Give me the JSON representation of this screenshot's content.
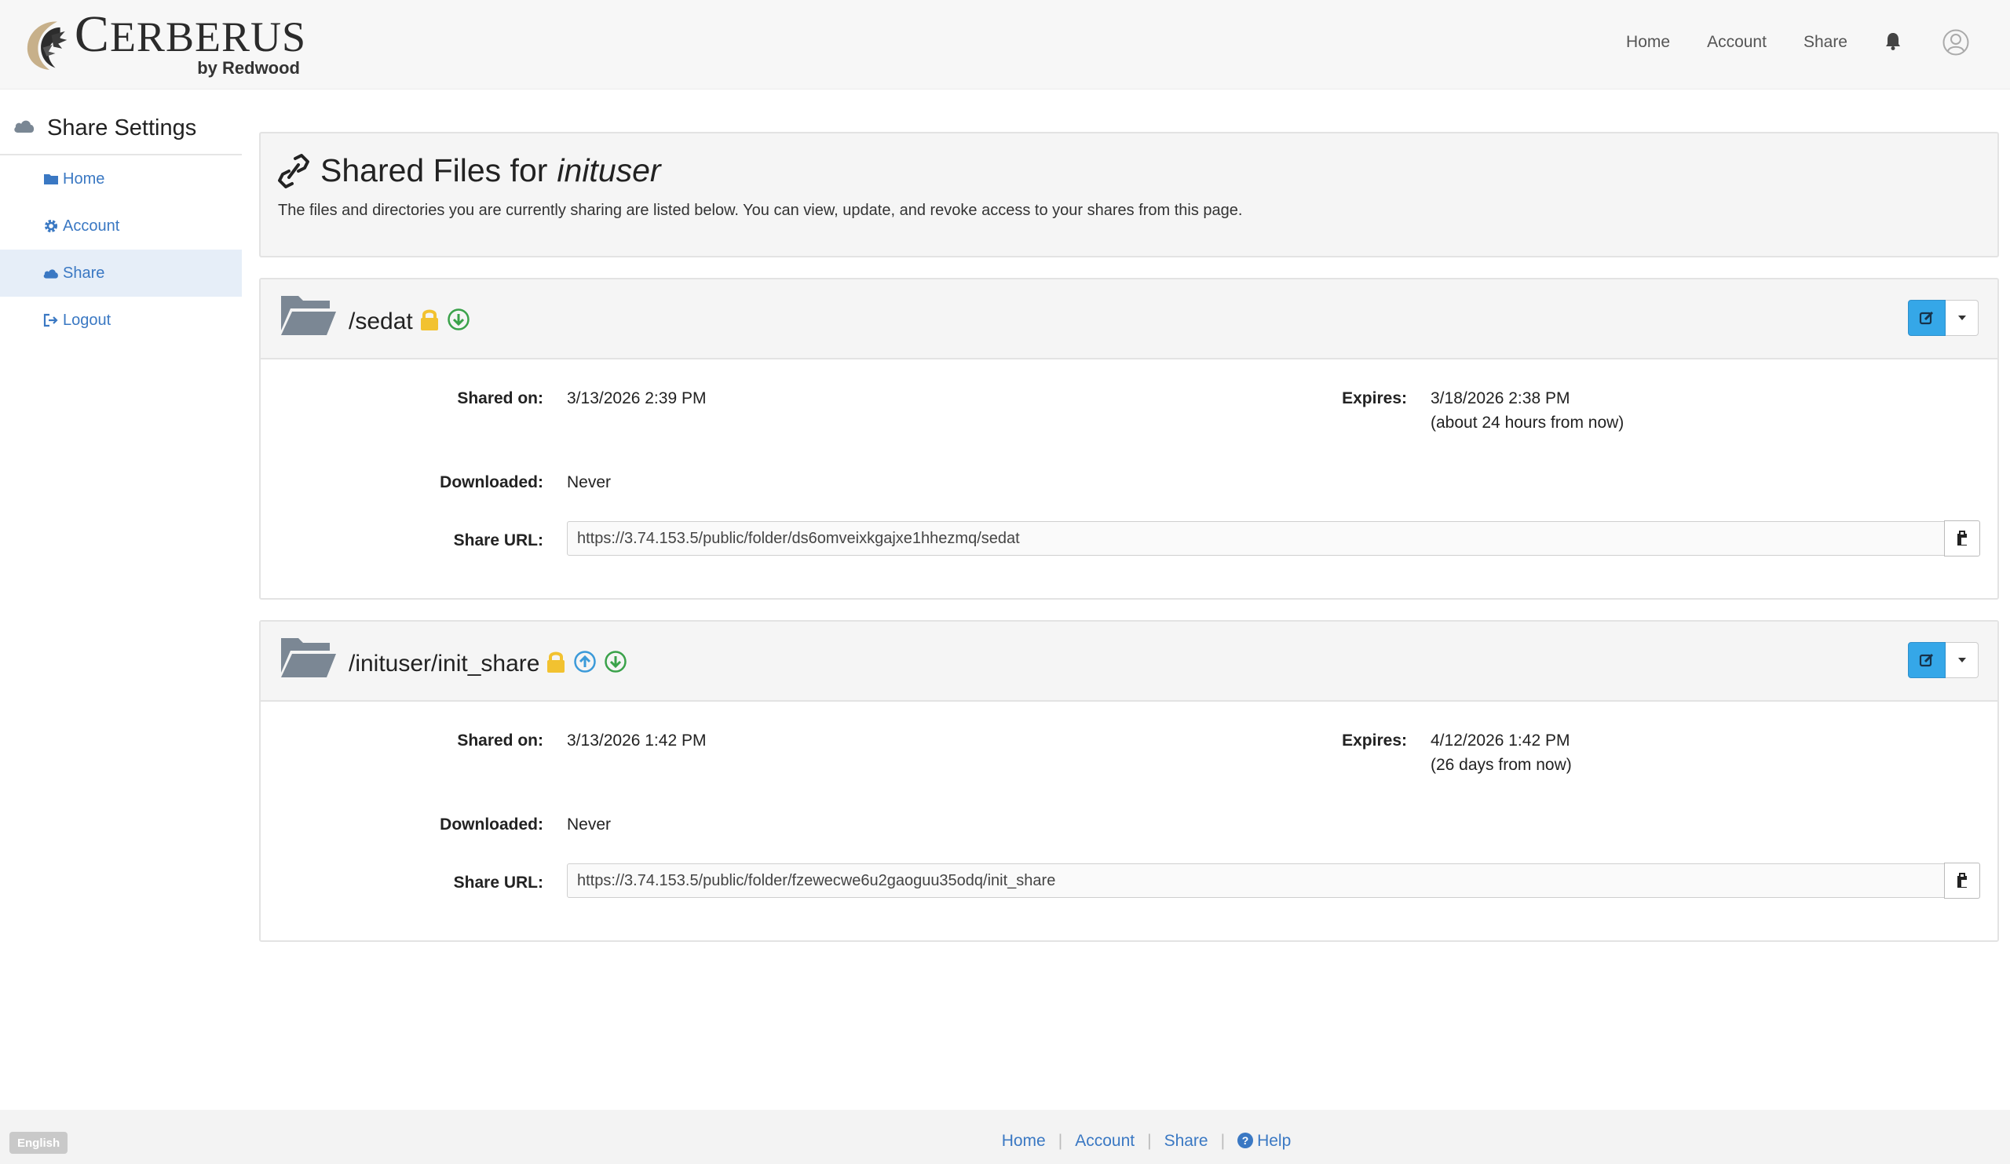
{
  "header": {
    "brand": {
      "word_big": "C",
      "word_rest": "ERBERUS",
      "by": "by Redwood"
    },
    "nav": [
      "Home",
      "Account",
      "Share"
    ]
  },
  "sidebar": {
    "title": "Share Settings",
    "items": [
      {
        "label": "Home",
        "icon": "folder-icon"
      },
      {
        "label": "Account",
        "icon": "gear-icon"
      },
      {
        "label": "Share",
        "icon": "cloud-icon",
        "active": true
      },
      {
        "label": "Logout",
        "icon": "logout-icon"
      }
    ]
  },
  "page": {
    "title_prefix": "Shared Files for",
    "title_user": "inituser",
    "description": "The files and directories you are currently sharing are listed below. You can view, update, and revoke access to your shares from this page."
  },
  "labels": {
    "shared_on": "Shared on:",
    "expires": "Expires:",
    "downloaded": "Downloaded:",
    "share_url": "Share URL:"
  },
  "shares": [
    {
      "path": "/sedat",
      "shared_on": "3/13/2026 2:39 PM",
      "expires": "3/18/2026 2:38 PM",
      "expires_relative": "(about 24 hours from now)",
      "downloaded": "Never",
      "url": "https://3.74.153.5/public/folder/ds6omveixkgajxe1hhezmq/sedat"
    },
    {
      "path": "/inituser/init_share",
      "shared_on": "3/13/2026 1:42 PM",
      "expires": "4/12/2026 1:42 PM",
      "expires_relative": "(26 days from now)",
      "downloaded": "Never",
      "url": "https://3.74.153.5/public/folder/fzewecwe6u2gaoguu35odq/init_share"
    }
  ],
  "footer": {
    "language": "English",
    "links": [
      "Home",
      "Account",
      "Share",
      "Help"
    ]
  },
  "colors": {
    "link": "#3a78c3",
    "accent_button": "#35a7e8",
    "lock": "#f2c230",
    "upload": "#3b9ad9",
    "download": "#3aa24a"
  }
}
